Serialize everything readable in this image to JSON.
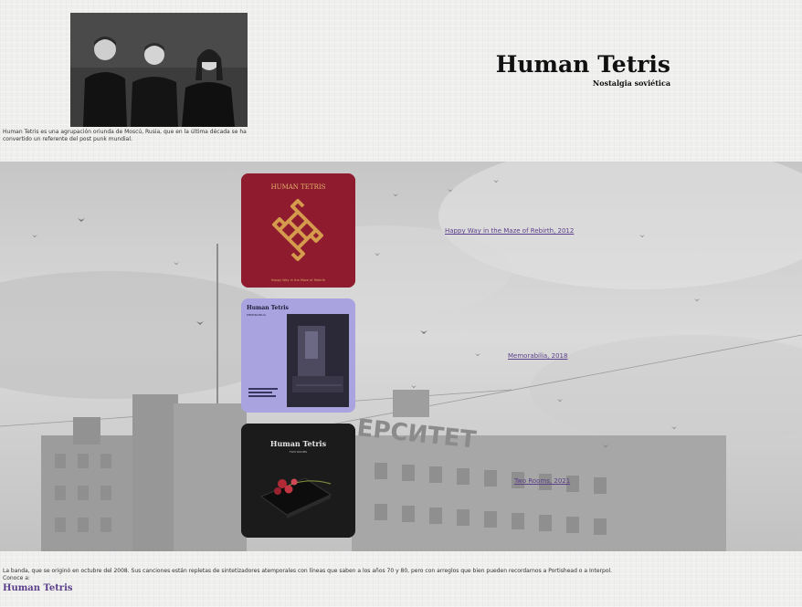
{
  "header": {
    "title": "Human Tetris",
    "subtitle": "Nostalgia soviética",
    "intro": "Human Tetris es una agrupación oriunda de Moscú, Rusia, que en la última década se ha convertido un referente del post punk mundial."
  },
  "albums": [
    {
      "cover_title": "HUMAN TETRIS",
      "cover_caption": "Happy Way in the Maze of Rebirth",
      "link": "Happy Way in the Maze of Rebirth, 2012",
      "cover_color": "#8e1b2e"
    },
    {
      "cover_title": "Human Tetris",
      "cover_caption": "MEMORABILIA",
      "link": "Memorabilia, 2018",
      "cover_color": "#a9a3e0"
    },
    {
      "cover_title": "Human Tetris",
      "cover_caption": "TWO ROOMS",
      "link": "Two Rooms, 2021",
      "cover_color": "#1b1b1b"
    }
  ],
  "footer": {
    "text": "La banda, que se originó en octubre del 2008. Sus canciones están repletas de sintetizadores atemporales con líneas que saben a los años 70 y 80, pero con arreglos que bien pueden recordarnos a Portishead o a Interpol.",
    "know_label": "Conoce a:",
    "link": "Human Tetris"
  },
  "colors": {
    "link": "#5b3f8a",
    "background": "#efefee"
  }
}
